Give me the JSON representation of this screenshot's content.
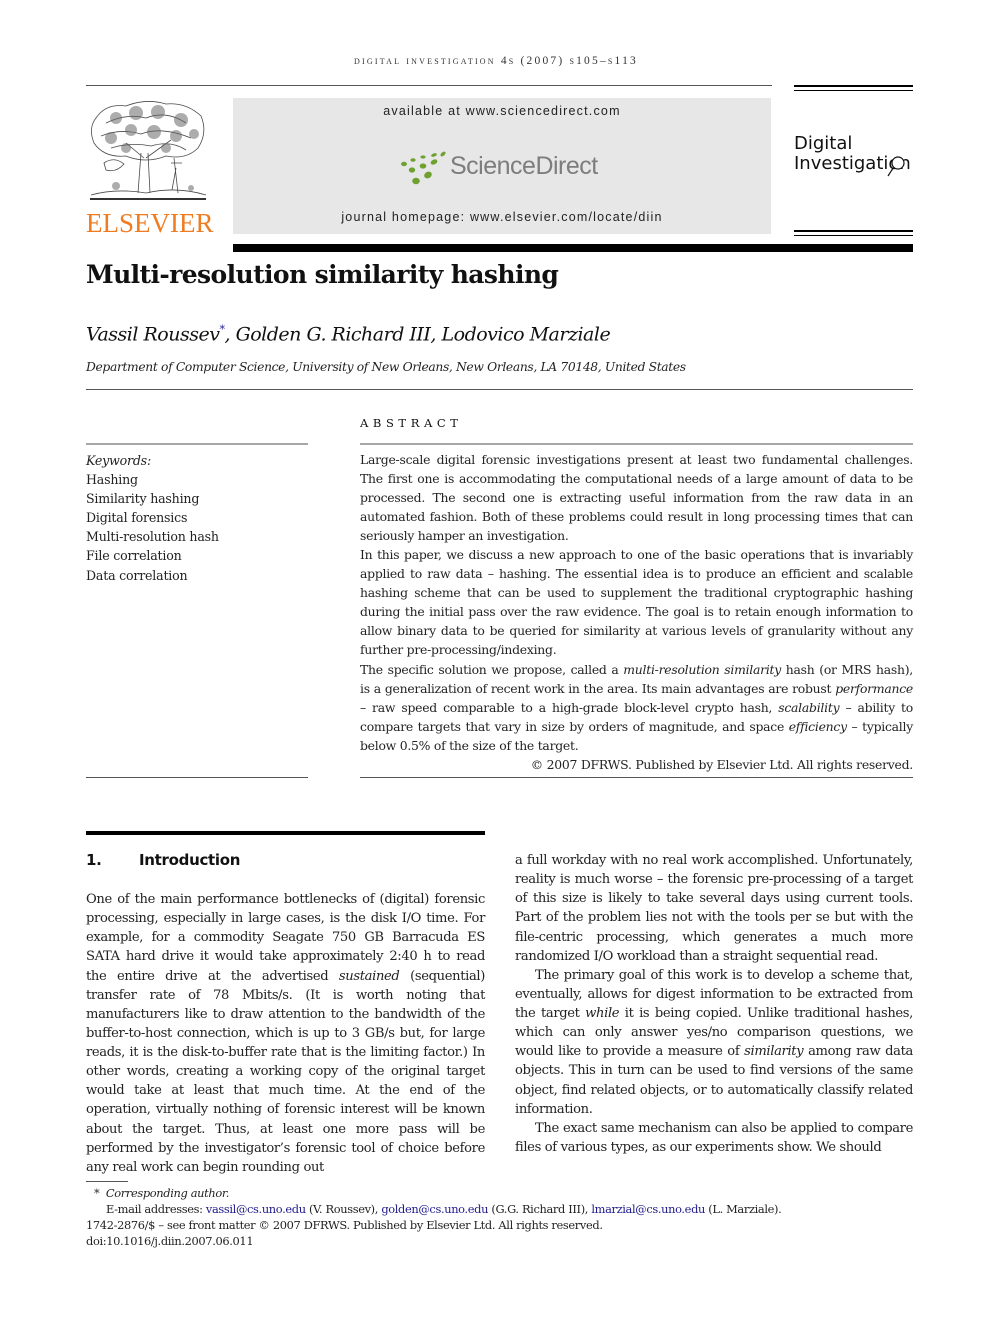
{
  "running_header": "digital investigation 4S (2007) S105–S113",
  "publisher": {
    "name": "ELSEVIER",
    "brand_color": "#f07c22"
  },
  "sciencedirect": {
    "available_at": "available at www.sciencedirect.com",
    "logo_text": "ScienceDirect",
    "logo_dot_color": "#6ea12f",
    "journal_homepage": "journal homepage: www.elsevier.com/locate/diin"
  },
  "journal_logo": {
    "line1": "Digital",
    "line2": "Investigation"
  },
  "article": {
    "title": "Multi-resolution similarity hashing",
    "authors": [
      {
        "name": "Vassil Roussev",
        "marker": "*"
      },
      {
        "name": "Golden G. Richard III"
      },
      {
        "name": "Lodovico Marziale"
      }
    ],
    "author_separator": ", ",
    "affiliation": "Department of Computer Science, University of New Orleans, New Orleans, LA 70148, United States"
  },
  "keywords": {
    "label": "Keywords:",
    "items": [
      "Hashing",
      "Similarity hashing",
      "Digital forensics",
      "Multi-resolution hash",
      "File correlation",
      "Data correlation"
    ]
  },
  "abstract": {
    "heading": "ABSTRACT",
    "p1": "Large-scale digital forensic investigations present at least two fundamental challenges. The first one is accommodating the computational needs of a large amount of data to be processed. The second one is extracting useful information from the raw data in an automated fashion. Both of these problems could result in long processing times that can seriously hamper an investigation.",
    "p2": "In this paper, we discuss a new approach to one of the basic operations that is invariably applied to raw data – hashing. The essential idea is to produce an efficient and scalable hashing scheme that can be used to supplement the traditional cryptographic hashing during the initial pass over the raw evidence. The goal is to retain enough information to allow binary data to be queried for similarity at various levels of granularity without any further pre-processing/indexing.",
    "p3": {
      "a": "The specific solution we propose, called a ",
      "em1": "multi-resolution similarity",
      "b": " hash (or MRS hash), is a generalization of recent work in the area. Its main advantages are robust ",
      "em2": "performance",
      "c": " – raw speed comparable to a high-grade block-level crypto hash, ",
      "em3": "scalability",
      "d": " – ability to compare targets that vary in size by orders of magnitude, and space ",
      "em4": "efficiency",
      "e": " – typically below 0.5% of the size of the target."
    },
    "copyright": "© 2007 DFRWS. Published by Elsevier Ltd. All rights reserved."
  },
  "section": {
    "number": "1.",
    "title": "Introduction"
  },
  "body_left": {
    "a": "One of the main performance bottlenecks of (digital) forensic processing, especially in large cases, is the disk I/O time. For example, for a commodity Seagate 750 GB Barracuda ES SATA hard drive it would take approximately 2:40 h to read the entire drive at the advertised ",
    "em": "sustained",
    "b": " (sequential) transfer rate of 78 Mbits/s. (It is worth noting that manufacturers like to draw attention to the bandwidth of the buffer-to-host connection, which is up to 3 GB/s but, for large reads, it is the disk-to-buffer rate that is the limiting factor.) In other words, creating a working copy of the original target would take at least that much time. At the end of the operation, virtually nothing of forensic interest will be known about the target. Thus, at least one more pass will be performed by the investigator’s forensic tool of choice before any real work can begin rounding out"
  },
  "body_right": {
    "p1": "a full workday with no real work accomplished. Unfortunately, reality is much worse – the forensic pre-processing of a target of this size is likely to take several days using current tools. Part of the problem lies not with the tools per se but with the file-centric processing, which generates a much more randomized I/O workload than a straight sequential read.",
    "p2": {
      "a": "The primary goal of this work is to develop a scheme that, eventually, allows for digest information to be extracted from the target ",
      "em1": "while",
      "b": " it is being copied. Unlike traditional hashes, which can only answer yes/no comparison questions, we would like to provide a measure of ",
      "em2": "similarity",
      "c": " among raw data objects. This in turn can be used to find versions of the same object, find related objects, or to automatically classify related information."
    },
    "p3": "The exact same mechanism can also be applied to compare files of various types, as our experiments show. We should"
  },
  "footnotes": {
    "marker": "*",
    "corresponding": "Corresponding author.",
    "email_label": "E-mail addresses: ",
    "emails": [
      {
        "address": "vassil@cs.uno.edu",
        "who": " (V. Roussev), "
      },
      {
        "address": "golden@cs.uno.edu",
        "who": " (G.G. Richard III), "
      },
      {
        "address": "lmarzial@cs.uno.edu",
        "who": " (L. Marziale)."
      }
    ],
    "issn_line": "1742-2876/$ – see front matter © 2007 DFRWS. Published by Elsevier Ltd. All rights reserved.",
    "doi": "doi:10.1016/j.diin.2007.06.011"
  }
}
